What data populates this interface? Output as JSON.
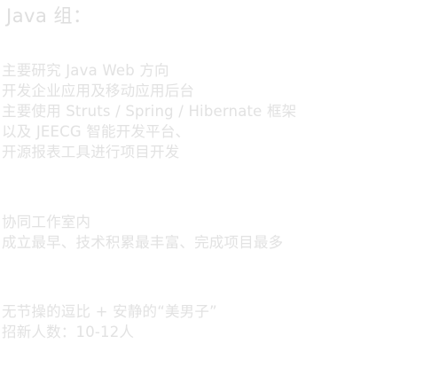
{
  "title": "Java 组：",
  "blocks": [
    {
      "lines": [
        "主要研究 Java Web 方向",
        "开发企业应用及移动应用后台",
        "主要使用 Struts / Spring / Hibernate 框架",
        "以及 JEECG 智能开发平台、",
        "开源报表工具进行项目开发"
      ]
    },
    {
      "lines": [
        "协同工作室内",
        "成立最早、技术积累最丰富、完成项目最多"
      ]
    },
    {
      "lines": [
        "无节操的逗比 + 安静的“美男子”",
        "招新人数：10-12人"
      ]
    }
  ]
}
